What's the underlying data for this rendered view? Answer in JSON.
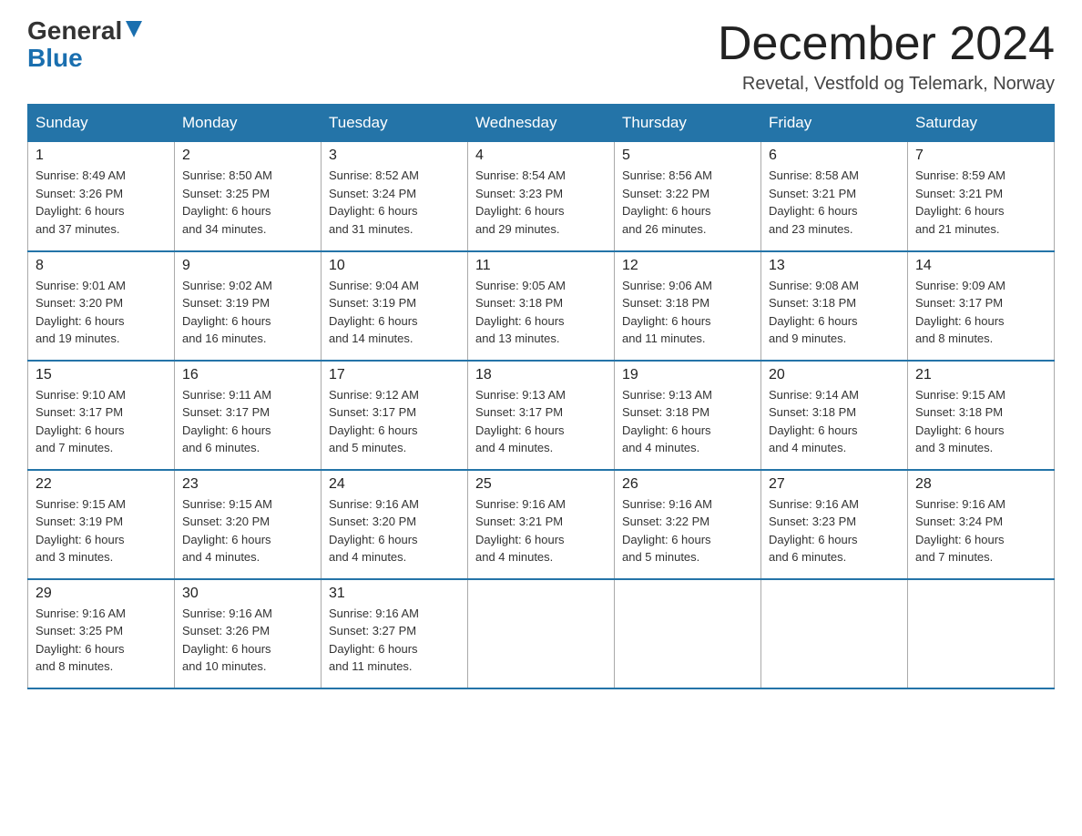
{
  "header": {
    "logo_line1": "General",
    "logo_line2": "Blue",
    "month_title": "December 2024",
    "location": "Revetal, Vestfold og Telemark, Norway"
  },
  "days_of_week": [
    "Sunday",
    "Monday",
    "Tuesday",
    "Wednesday",
    "Thursday",
    "Friday",
    "Saturday"
  ],
  "weeks": [
    [
      {
        "day": "1",
        "info": "Sunrise: 8:49 AM\nSunset: 3:26 PM\nDaylight: 6 hours\nand 37 minutes."
      },
      {
        "day": "2",
        "info": "Sunrise: 8:50 AM\nSunset: 3:25 PM\nDaylight: 6 hours\nand 34 minutes."
      },
      {
        "day": "3",
        "info": "Sunrise: 8:52 AM\nSunset: 3:24 PM\nDaylight: 6 hours\nand 31 minutes."
      },
      {
        "day": "4",
        "info": "Sunrise: 8:54 AM\nSunset: 3:23 PM\nDaylight: 6 hours\nand 29 minutes."
      },
      {
        "day": "5",
        "info": "Sunrise: 8:56 AM\nSunset: 3:22 PM\nDaylight: 6 hours\nand 26 minutes."
      },
      {
        "day": "6",
        "info": "Sunrise: 8:58 AM\nSunset: 3:21 PM\nDaylight: 6 hours\nand 23 minutes."
      },
      {
        "day": "7",
        "info": "Sunrise: 8:59 AM\nSunset: 3:21 PM\nDaylight: 6 hours\nand 21 minutes."
      }
    ],
    [
      {
        "day": "8",
        "info": "Sunrise: 9:01 AM\nSunset: 3:20 PM\nDaylight: 6 hours\nand 19 minutes."
      },
      {
        "day": "9",
        "info": "Sunrise: 9:02 AM\nSunset: 3:19 PM\nDaylight: 6 hours\nand 16 minutes."
      },
      {
        "day": "10",
        "info": "Sunrise: 9:04 AM\nSunset: 3:19 PM\nDaylight: 6 hours\nand 14 minutes."
      },
      {
        "day": "11",
        "info": "Sunrise: 9:05 AM\nSunset: 3:18 PM\nDaylight: 6 hours\nand 13 minutes."
      },
      {
        "day": "12",
        "info": "Sunrise: 9:06 AM\nSunset: 3:18 PM\nDaylight: 6 hours\nand 11 minutes."
      },
      {
        "day": "13",
        "info": "Sunrise: 9:08 AM\nSunset: 3:18 PM\nDaylight: 6 hours\nand 9 minutes."
      },
      {
        "day": "14",
        "info": "Sunrise: 9:09 AM\nSunset: 3:17 PM\nDaylight: 6 hours\nand 8 minutes."
      }
    ],
    [
      {
        "day": "15",
        "info": "Sunrise: 9:10 AM\nSunset: 3:17 PM\nDaylight: 6 hours\nand 7 minutes."
      },
      {
        "day": "16",
        "info": "Sunrise: 9:11 AM\nSunset: 3:17 PM\nDaylight: 6 hours\nand 6 minutes."
      },
      {
        "day": "17",
        "info": "Sunrise: 9:12 AM\nSunset: 3:17 PM\nDaylight: 6 hours\nand 5 minutes."
      },
      {
        "day": "18",
        "info": "Sunrise: 9:13 AM\nSunset: 3:17 PM\nDaylight: 6 hours\nand 4 minutes."
      },
      {
        "day": "19",
        "info": "Sunrise: 9:13 AM\nSunset: 3:18 PM\nDaylight: 6 hours\nand 4 minutes."
      },
      {
        "day": "20",
        "info": "Sunrise: 9:14 AM\nSunset: 3:18 PM\nDaylight: 6 hours\nand 4 minutes."
      },
      {
        "day": "21",
        "info": "Sunrise: 9:15 AM\nSunset: 3:18 PM\nDaylight: 6 hours\nand 3 minutes."
      }
    ],
    [
      {
        "day": "22",
        "info": "Sunrise: 9:15 AM\nSunset: 3:19 PM\nDaylight: 6 hours\nand 3 minutes."
      },
      {
        "day": "23",
        "info": "Sunrise: 9:15 AM\nSunset: 3:20 PM\nDaylight: 6 hours\nand 4 minutes."
      },
      {
        "day": "24",
        "info": "Sunrise: 9:16 AM\nSunset: 3:20 PM\nDaylight: 6 hours\nand 4 minutes."
      },
      {
        "day": "25",
        "info": "Sunrise: 9:16 AM\nSunset: 3:21 PM\nDaylight: 6 hours\nand 4 minutes."
      },
      {
        "day": "26",
        "info": "Sunrise: 9:16 AM\nSunset: 3:22 PM\nDaylight: 6 hours\nand 5 minutes."
      },
      {
        "day": "27",
        "info": "Sunrise: 9:16 AM\nSunset: 3:23 PM\nDaylight: 6 hours\nand 6 minutes."
      },
      {
        "day": "28",
        "info": "Sunrise: 9:16 AM\nSunset: 3:24 PM\nDaylight: 6 hours\nand 7 minutes."
      }
    ],
    [
      {
        "day": "29",
        "info": "Sunrise: 9:16 AM\nSunset: 3:25 PM\nDaylight: 6 hours\nand 8 minutes."
      },
      {
        "day": "30",
        "info": "Sunrise: 9:16 AM\nSunset: 3:26 PM\nDaylight: 6 hours\nand 10 minutes."
      },
      {
        "day": "31",
        "info": "Sunrise: 9:16 AM\nSunset: 3:27 PM\nDaylight: 6 hours\nand 11 minutes."
      },
      null,
      null,
      null,
      null
    ]
  ]
}
